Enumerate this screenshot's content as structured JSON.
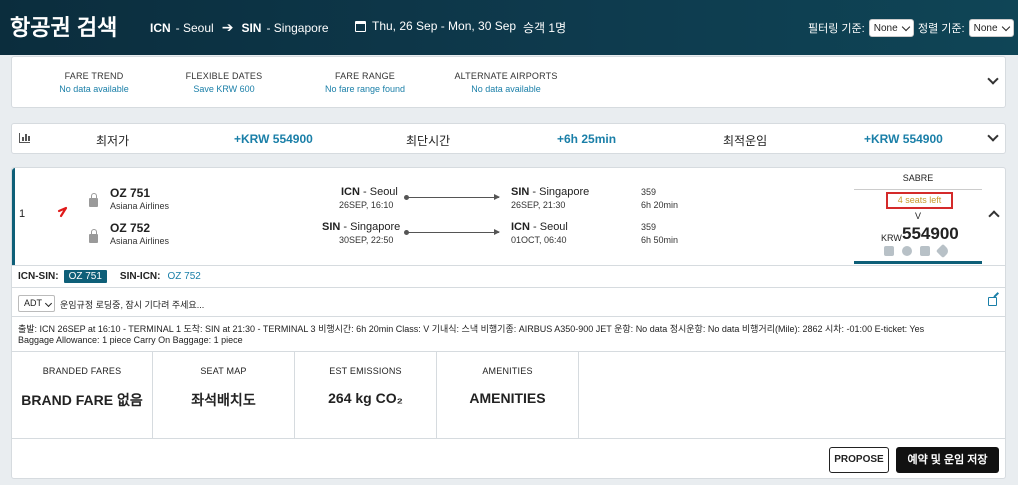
{
  "header": {
    "title": "항공권 검색",
    "origin_code": "ICN",
    "origin_city": "- Seoul",
    "dest_code": "SIN",
    "dest_city": "- Singapore",
    "dates": "Thu, 26 Sep - Mon, 30 Sep",
    "passengers": "승객 1명",
    "filter_label": "필터링 기준:",
    "filter_value": "None",
    "sort_label": "정렬 기준:",
    "sort_value": "None"
  },
  "fare_panel": {
    "items": [
      {
        "label": "FARE TREND",
        "value": "No data available"
      },
      {
        "label": "FLEXIBLE DATES",
        "value": "Save KRW 600"
      },
      {
        "label": "FARE RANGE",
        "value": "No fare range found"
      },
      {
        "label": "ALTERNATE AIRPORTS",
        "value": "No data available"
      }
    ]
  },
  "summary": {
    "cheapest_label": "최저가",
    "cheapest_value": "+KRW 554900",
    "shortest_label": "최단시간",
    "shortest_value": "+6h 25min",
    "best_label": "최적운임",
    "best_value": "+KRW 554900"
  },
  "result": {
    "index": "1",
    "outbound": {
      "flight": "OZ 751",
      "airline": "Asiana Airlines",
      "dep_code": "ICN",
      "dep_city": "- Seoul",
      "dep_time": "26SEP, 16:10",
      "arr_code": "SIN",
      "arr_city": "- Singapore",
      "arr_time": "26SEP, 21:30",
      "equipment": "359",
      "duration": "6h 20min"
    },
    "inbound": {
      "flight": "OZ 752",
      "airline": "Asiana Airlines",
      "dep_code": "SIN",
      "dep_city": "- Singapore",
      "dep_time": "30SEP, 22:50",
      "arr_code": "ICN",
      "arr_city": "- Seoul",
      "arr_time": "01OCT, 06:40",
      "equipment": "359",
      "duration": "6h 50min"
    },
    "source": "SABRE",
    "seats_left": "4 seats left",
    "fare_class": "V",
    "currency": "KRW",
    "price": "554900"
  },
  "tabs": {
    "out_label": "ICN-SIN:",
    "out_value": "OZ 751",
    "in_label": "SIN-ICN:",
    "in_value": "OZ 752"
  },
  "rules": {
    "pax_type": "ADT",
    "loading_text": "운임규정 로딩중, 잠시 기다려 주세요..."
  },
  "details": {
    "line1": "출발: ICN 26SEP at 16:10 - TERMINAL 1   도착: SIN at 21:30 - TERMINAL 3   비행시간: 6h 20min   Class: V   기내식: 스낵   비행기종: AIRBUS A350-900 JET   운항: No data   정시운항: No data   비행거리(Mile): 2862   시차: -01:00   E-ticket: Yes",
    "line2": "Baggage Allowance: 1 piece   Carry On Baggage: 1 piece"
  },
  "features": [
    {
      "label": "BRANDED FARES",
      "value": "BRAND FARE 없음"
    },
    {
      "label": "SEAT MAP",
      "value": "좌석배치도"
    },
    {
      "label": "EST EMISSIONS",
      "value": "264 kg CO₂"
    },
    {
      "label": "AMENITIES",
      "value": "AMENITIES"
    }
  ],
  "actions": {
    "propose": "PROPOSE",
    "save": "예약 및 운임 저장"
  },
  "colors": {
    "header_bg": "#0e3b4e",
    "accent": "#1a7fa8",
    "seats_border": "#d42a2a"
  }
}
